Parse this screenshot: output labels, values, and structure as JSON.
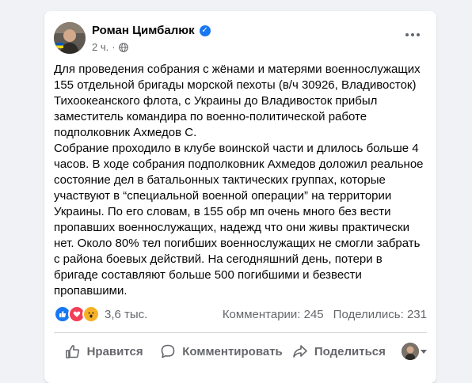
{
  "post": {
    "author": "Роман Цимбалюк",
    "time": "2 ч.",
    "paragraphs": [
      "Для проведения собрания с жёнами и матерями военнослужащих 155 отдельной бригады морской пехоты (в/ч 30926, Владивосток) Тихоокеанского флота, с Украины до Владивосток прибыл заместитель командира по военно-политической работе подполковник Ахмедов С.",
      "Собрание проходило в клубе воинской части и длилось больше 4 часов. В ходе собрания подполковник Ахмедов доложил реальное состояние дел в батальонных тактических группах, которые участвуют в “специальной военной операции” на территории Украины. По его словам, в 155 обр мп очень много без вести пропавших военнослужащих, надежд что они живы практически нет. Около 80% тел погибших военнослужащих не смогли забрать с района боевых действий. На сегодняшний день, потери в бригаде составляют больше 500 погибшими и безвести пропавшими."
    ]
  },
  "stats": {
    "reactions_count": "3,6 тыс.",
    "comments": "Комментарии: 245",
    "shares": "Поделились: 231"
  },
  "actions": {
    "like": "Нравится",
    "comment": "Комментировать",
    "share": "Поделиться"
  },
  "icons": {
    "verified": "verified-badge-icon",
    "privacy": "globe-icon",
    "menu": "more-dots-icon",
    "reactions": [
      "like-icon",
      "love-icon",
      "wow-icon"
    ]
  },
  "colors": {
    "accent": "#1877f2",
    "secondary_text": "#65676b",
    "love": "#f33e58",
    "wow": "#f7b125"
  }
}
